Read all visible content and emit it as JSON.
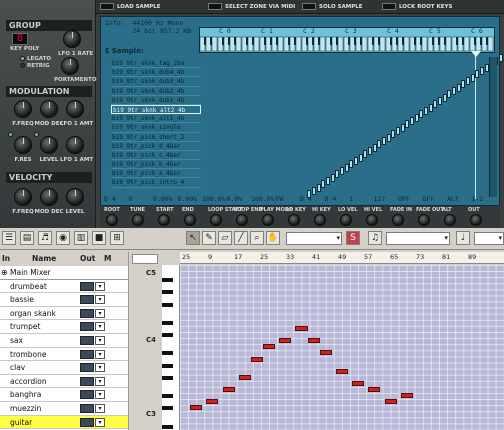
{
  "nnxt": {
    "group_title": "GROUP",
    "key_poly_value": "8",
    "key_poly_label": "KEY POLY",
    "lfo1_rate_label": "LFO 1 RATE",
    "legato_label": "LEGATO",
    "retrig_label": "RETRIG",
    "portamento_label": "PORTAMENTO",
    "modulation_title": "MODULATION",
    "mod_labels": [
      "F.FREQ",
      "MOD DEC",
      "LFO 1 AMT",
      "F.RES",
      "LEVEL",
      "LFO 1 AMT"
    ],
    "velocity_title": "VELOCITY",
    "vel_labels": [
      "F.FREQ",
      "MOD DEC",
      "LEVEL"
    ],
    "toolbar": {
      "load_sample": "LOAD SAMPLE",
      "select_zone_via_midi": "SELECT ZONE VIA MIDI",
      "solo_sample": "SOLO SAMPLE",
      "lock_root_keys": "LOCK ROOT KEYS"
    },
    "info_text": "Info:  44100 Hz Mono\n       24 bit 957.2 KB",
    "sample_header": "ℇ Sample:",
    "key_labels": [
      "C 0",
      "C 1",
      "C 2",
      "C 3",
      "C 4",
      "C 5",
      "C 6"
    ],
    "samples": [
      "bi9_9tr_sknk_tag_2ba",
      "bi9_9tr_sknk_dub4_4b",
      "bi9_9tr_sknk_dub3_4b",
      "bi9_9tr_sknk_dub2_4b",
      "bi9_9tr_sknk_dub1_4b",
      "bi9_9tr_sknk_alt2_4b",
      "bi9_9tr_sknk_alt1_4b",
      "bi9_9tr_sknk_single_",
      "bi9_9tr_pick_short_2",
      "bi9_9tr_pick_d_4bar",
      "bi9_9tr_pick_c_4bar",
      "bi9_9tr_pick_b_4bar",
      "bi9_9tr_pick_a_4bar",
      "bi9_9tr_pick_intro_4"
    ],
    "selected_sample_index": 5,
    "param_values": [
      "D 4",
      "0",
      "0.00%",
      "0.00%",
      "100.0%",
      "0.0%",
      "100.0%",
      "FW",
      "D 4",
      "D 4",
      "1",
      "127",
      "OFF",
      "OFF",
      "ALT",
      "1-2"
    ],
    "param_labels": [
      "ROOT",
      "TUNE",
      "START",
      "END",
      "LOOP START",
      "LOOP END",
      "PLAY MODE",
      "LO KEY",
      "HI KEY",
      "LO VEL",
      "HI VEL",
      "FADE IN",
      "FADE OUT",
      "ALT",
      "OUT"
    ]
  },
  "sequencer": {
    "toolbar_dropdowns": [
      "",
      "",
      ""
    ],
    "track_header": {
      "in": "In",
      "name": "Name",
      "out": "Out",
      "m": "M"
    },
    "tracks": [
      {
        "name": "Main Mixer",
        "type": "mixer"
      },
      {
        "name": "drumbeat"
      },
      {
        "name": "bassie"
      },
      {
        "name": "organ skank"
      },
      {
        "name": "trumpet"
      },
      {
        "name": "sax"
      },
      {
        "name": "trombone"
      },
      {
        "name": "clav"
      },
      {
        "name": "accordion"
      },
      {
        "name": "banghra"
      },
      {
        "name": "muezzin"
      },
      {
        "name": "guitar"
      }
    ],
    "selected_track_index": 11,
    "ruler_ticks": [
      "25",
      "9",
      "17",
      "25",
      "33",
      "41",
      "49",
      "57",
      "65",
      "73",
      "81",
      "89"
    ],
    "octave_labels": [
      "C5",
      "C4",
      "C3"
    ],
    "notes": [
      {
        "pitch_row": 23,
        "start": 1,
        "len": 1.5
      },
      {
        "pitch_row": 22,
        "start": 3,
        "len": 1.5
      },
      {
        "pitch_row": 20,
        "start": 5,
        "len": 1.5
      },
      {
        "pitch_row": 18,
        "start": 7,
        "len": 1.5
      },
      {
        "pitch_row": 15,
        "start": 8.5,
        "len": 1.5
      },
      {
        "pitch_row": 13,
        "start": 10,
        "len": 1.5
      },
      {
        "pitch_row": 12,
        "start": 12,
        "len": 1.5
      },
      {
        "pitch_row": 10,
        "start": 14,
        "len": 1.5
      },
      {
        "pitch_row": 12,
        "start": 15.5,
        "len": 1.5
      },
      {
        "pitch_row": 14,
        "start": 17,
        "len": 1.5
      },
      {
        "pitch_row": 17,
        "start": 19,
        "len": 1.5
      },
      {
        "pitch_row": 19,
        "start": 21,
        "len": 1.5
      },
      {
        "pitch_row": 20,
        "start": 23,
        "len": 1.5
      },
      {
        "pitch_row": 22,
        "start": 25,
        "len": 1.5
      },
      {
        "pitch_row": 21,
        "start": 27,
        "len": 1.5
      }
    ]
  }
}
